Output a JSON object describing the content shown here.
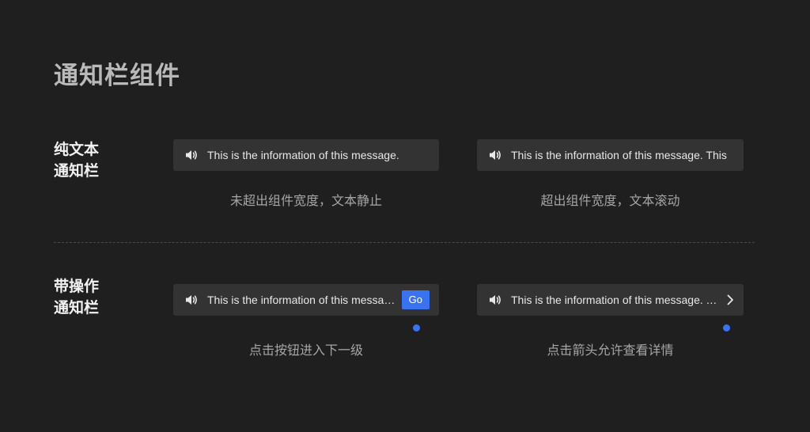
{
  "title": "通知栏组件",
  "colors": {
    "background": "#1f1f1f",
    "bar_background": "#333333",
    "accent": "#3a73f0"
  },
  "sections": [
    {
      "label": "纯文本\n通知栏",
      "items": [
        {
          "icon": "speaker-icon",
          "text": "This is the information of this message.",
          "caption": "未超出组件宽度，文本静止"
        },
        {
          "icon": "speaker-icon",
          "text": "This is the information of this message. This",
          "caption": "超出组件宽度，文本滚动"
        }
      ]
    },
    {
      "label": "带操作\n通知栏",
      "items": [
        {
          "icon": "speaker-icon",
          "text": "This is the information of this message.",
          "action_label": "Go",
          "caption": "点击按钮进入下一级"
        },
        {
          "icon": "speaker-icon",
          "text": "This is the information of this message. This",
          "action_icon": "chevron-right-icon",
          "caption": "点击箭头允许查看详情"
        }
      ]
    }
  ]
}
